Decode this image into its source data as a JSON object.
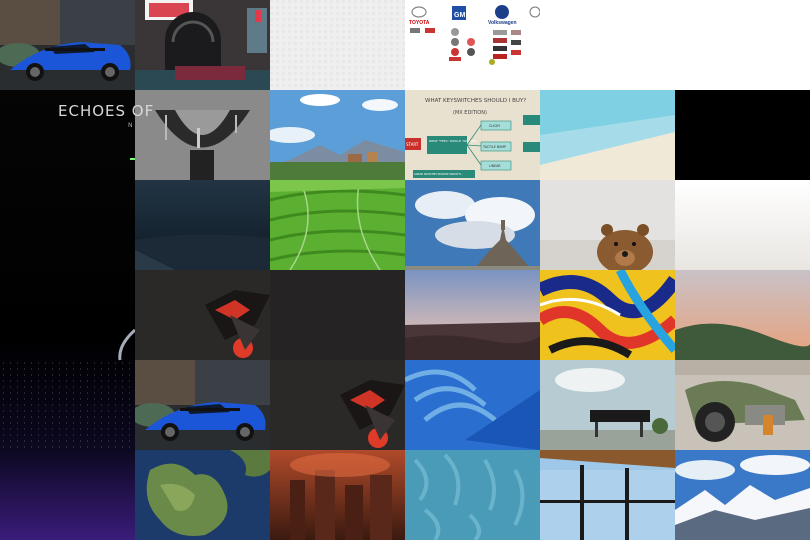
{
  "echoes": {
    "title": "ECHOES OF",
    "sub": "N"
  },
  "brands": {
    "toyota": "TOYOTA",
    "gm": "GM",
    "vw": "Volkswagen"
  },
  "flowchart": {
    "title": "WHAT KEYSWITCHES SHOULD I BUY?",
    "subtitle": "(MX EDITION)",
    "start": "START",
    "question": "WHAT \"FEEL\" WOULD YOU LIKE?",
    "clicky": "CLICKY",
    "tactile": "TACTILE BUMP",
    "linear": "LINEAR",
    "footer": "LINEAR SWITCHES PROVIDE SMOOTH..."
  }
}
